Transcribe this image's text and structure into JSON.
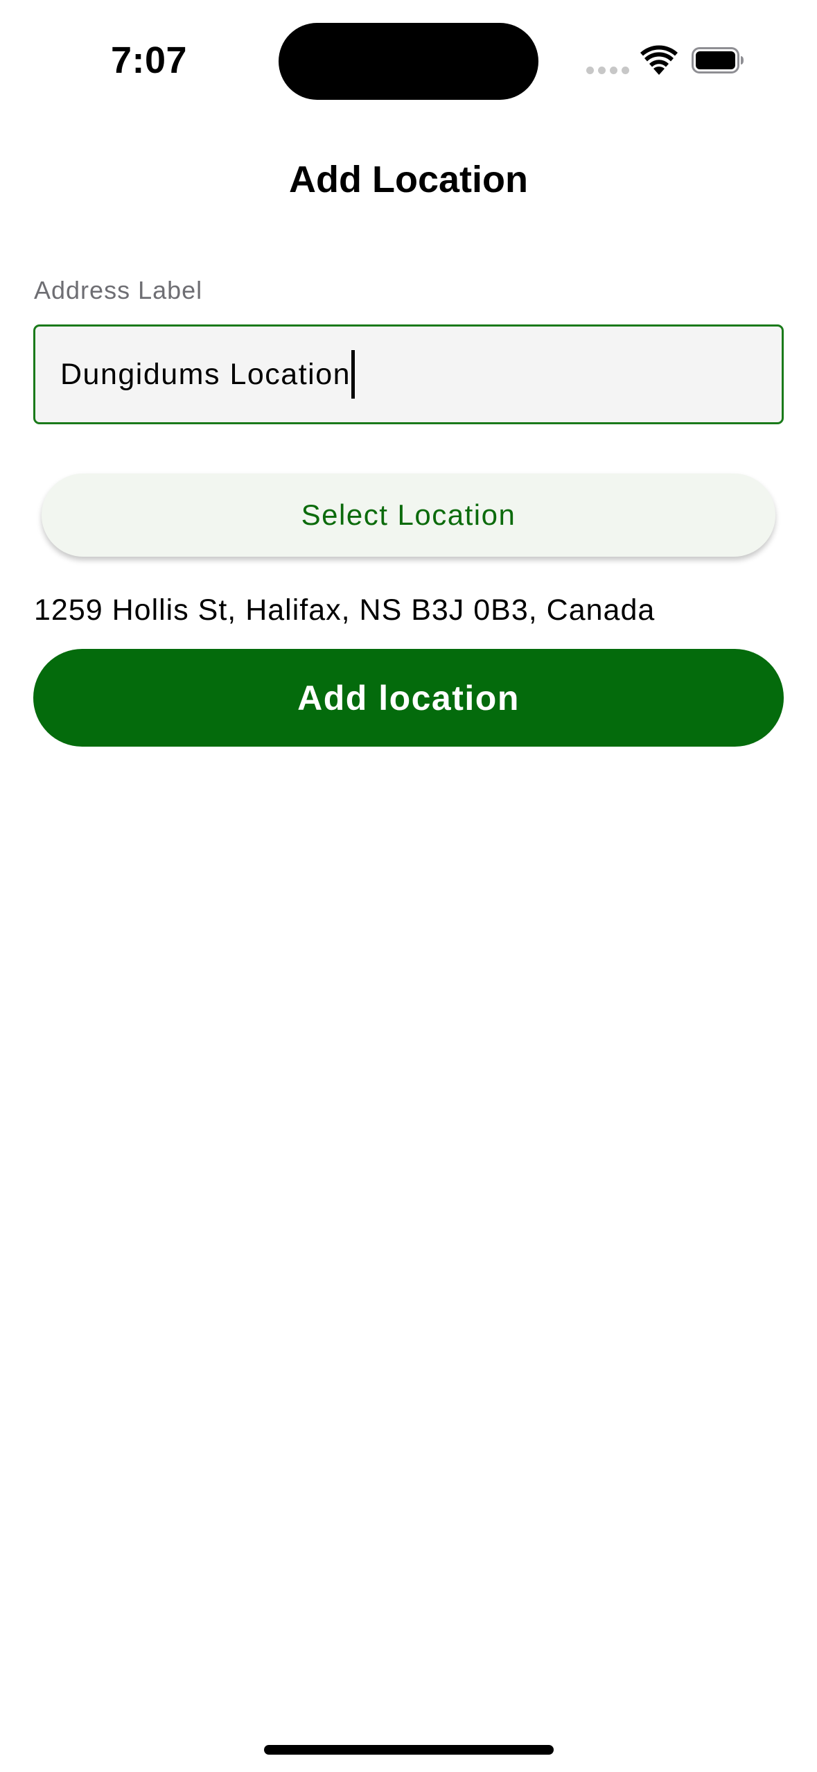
{
  "status_bar": {
    "time": "7:07"
  },
  "header": {
    "title": "Add Location"
  },
  "form": {
    "address_label": "Address Label",
    "address_label_value": "Dungidums Location",
    "select_location_label": "Select Location",
    "selected_address": "1259 Hollis St, Halifax, NS B3J 0B3, Canada",
    "add_location_label": "Add location"
  },
  "colors": {
    "accent": "#046b0c",
    "field_border": "#1a7a1a",
    "field_background": "#f4f4f4",
    "select_button_background": "#f2f6f0",
    "label_gray": "#6e6e73"
  }
}
